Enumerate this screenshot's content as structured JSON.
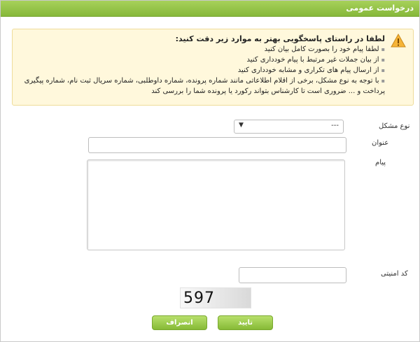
{
  "window": {
    "title": "درخواست عمومی"
  },
  "notice": {
    "heading": "لطفا در راستای پاسخگویی بهتر به موارد زیر دقت کنید:",
    "items": [
      "لطفا پیام خود را بصورت کامل بیان کنید",
      "از بیان جملات غیر مرتبط با پیام خودداری کنید",
      "از ارسال پیام های تکراری و مشابه خودداری کنید",
      "با توجه به نوع مشکل، برخی از اقلام اطلاعاتی مانند شماره پرونده، شماره داوطلبی، شماره سریال ثبت نام، شماره پیگیری پرداخت و ... ضروری است تا کارشناس بتواند رکورد یا پرونده شما را بررسی کند"
    ]
  },
  "form": {
    "problem_type_label": "نوع مشکل",
    "problem_type_value": "---",
    "title_label": "عنوان",
    "title_value": "",
    "message_label": "پیام",
    "message_value": "",
    "captcha_label": "کد امنیتی",
    "captcha_value": "",
    "captcha_code": "597"
  },
  "buttons": {
    "submit": "تایید",
    "cancel": "انصراف"
  },
  "colors": {
    "accent": "#8ac13e",
    "notice_bg": "#fff8dc"
  }
}
